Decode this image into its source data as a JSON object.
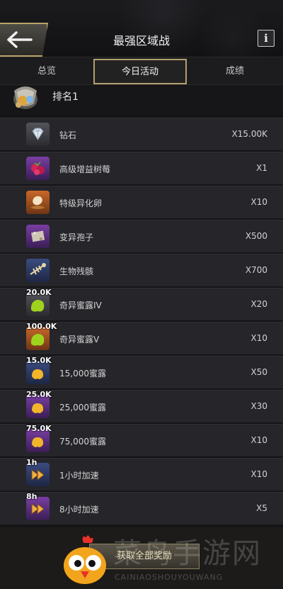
{
  "header": {
    "title": "最强区域战",
    "info_label": "i"
  },
  "tabs": [
    {
      "label": "总览"
    },
    {
      "label": "今日活动",
      "selected": true
    },
    {
      "label": "成绩"
    }
  ],
  "rank": {
    "label": "排名1"
  },
  "rewards": [
    {
      "name": "钻石",
      "qty": "X15.00K",
      "icon": "diamond-icon",
      "badge": ""
    },
    {
      "name": "高级增益树莓",
      "qty": "X1",
      "icon": "raspberry-icon",
      "badge": ""
    },
    {
      "name": "特级异化卵",
      "qty": "X10",
      "icon": "egg-icon",
      "badge": ""
    },
    {
      "name": "变异孢子",
      "qty": "X500",
      "icon": "spore-icon",
      "badge": ""
    },
    {
      "name": "生物残骸",
      "qty": "X700",
      "icon": "bone-fish-icon",
      "badge": ""
    },
    {
      "name": "奇异蜜露IV",
      "qty": "X20",
      "icon": "honeydew-icon",
      "badge": "20.0K"
    },
    {
      "name": "奇异蜜露V",
      "qty": "X10",
      "icon": "honeydew-icon",
      "badge": "100.0K"
    },
    {
      "name": "15,000蜜露",
      "qty": "X50",
      "icon": "honey-icon",
      "badge": "15.0K"
    },
    {
      "name": "25,000蜜露",
      "qty": "X30",
      "icon": "honey-icon",
      "badge": "25.0K"
    },
    {
      "name": "75,000蜜露",
      "qty": "X10",
      "icon": "honey-icon",
      "badge": "75.0K"
    },
    {
      "name": "1小时加速",
      "qty": "X10",
      "icon": "speedup-icon",
      "badge": "1h"
    },
    {
      "name": "8小时加速",
      "qty": "X5",
      "icon": "speedup-icon",
      "badge": "8h"
    }
  ],
  "footer": {
    "claim_label": "获取全部奖励",
    "watermark": "菜鸟手游网",
    "watermark_sub": "CAINIAOSHOUYOUWANG"
  }
}
